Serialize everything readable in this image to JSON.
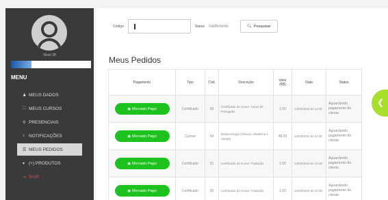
{
  "sidebar": {
    "level_label": "Nível 38",
    "progress": 0.26,
    "menu_title": "MENU",
    "items": [
      {
        "icon": "user-icon",
        "glyph": "♟",
        "label": "MEUS DADOS"
      },
      {
        "icon": "cart-icon",
        "glyph": "⛶",
        "label": "MEUS CURSOS"
      },
      {
        "icon": "location-icon",
        "glyph": "⚲",
        "label": "PRESENCIAIS"
      },
      {
        "icon": "bell-icon",
        "glyph": "♪",
        "label": "NOTIFICAÇÕES"
      },
      {
        "icon": "list-icon",
        "glyph": "☰",
        "label": "MEUS PEDIDOS"
      },
      {
        "icon": "cart-icon",
        "glyph": "▾",
        "label": "(+) PRODUTOS"
      },
      {
        "icon": "exit-icon",
        "glyph": "⇥",
        "label": "SAIR"
      }
    ]
  },
  "filter": {
    "code_label": "Código",
    "status_label": "Status",
    "status_value": "Indiferente",
    "search_label": "Pesquisar"
  },
  "page_title": "Meus Pedidos",
  "table": {
    "headers": [
      "Pagamento",
      "Tipo",
      "Cód.",
      "Descrição",
      "Valor (R$)",
      "Data",
      "Status"
    ],
    "pay_label": "Mercado Pago",
    "rows": [
      {
        "tipo": "Certificado",
        "cod": "59",
        "descricao": "Certificado do Curso: Curso de Português",
        "valor": "1.00",
        "data": "14/03/2024 às 13:01",
        "status": "Aguardando pagamento do cliente."
      },
      {
        "tipo": "Cursos",
        "cod": "54",
        "descricao": "Biotecnologia (Pessoa, Medicina e Saúde)",
        "valor": "48.00",
        "data": "14/03/2024 às 11:05",
        "status": "Aguardando pagamento do cliente."
      },
      {
        "tipo": "Certificado",
        "cod": "51",
        "descricao": "Certificado do Curso: Tradução",
        "valor": "1.00",
        "data": "14/03/2024 às 10:30",
        "status": "Aguardando pagamento do cliente."
      },
      {
        "tipo": "Certificado",
        "cod": "50",
        "descricao": "Certificado do Curso: Tradução",
        "valor": "1.00",
        "data": "14/03/2024 às 10:06",
        "status": "Aguardando pagamento do cliente."
      }
    ]
  },
  "colors": {
    "mercado_pago": "#1ec21e",
    "fab": "#a8df2a",
    "sidebar": "#3a3a3a"
  }
}
